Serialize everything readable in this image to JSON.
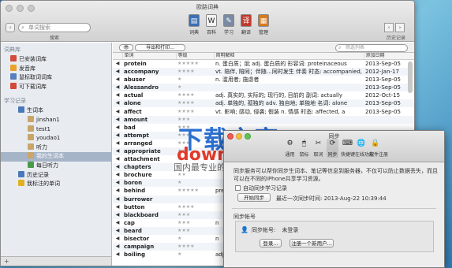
{
  "window": {
    "title": "欧路词典"
  },
  "search": {
    "placeholder": "单词搜索",
    "caption": "搜索",
    "icon": "magnifier-icon"
  },
  "history": {
    "caption": "历史记录"
  },
  "toolbar": [
    {
      "label": "词典",
      "icon": "book-icon",
      "color": "#3a6fb5"
    },
    {
      "label": "百科",
      "icon": "wikipedia-icon",
      "color": "#f2f2f2"
    },
    {
      "label": "学习",
      "icon": "learn-icon",
      "color": "#7a8aa3"
    },
    {
      "label": "翻译",
      "icon": "translate-icon",
      "color": "#c0392b"
    },
    {
      "label": "管理",
      "icon": "manage-icon",
      "color": "#d77b1c"
    }
  ],
  "sidebar": {
    "heading1": "词典库",
    "dict_items": [
      {
        "label": "已安装词库",
        "icon": "installed-icon",
        "color": "#d24a3a"
      },
      {
        "label": "发音库",
        "icon": "pronunciation-icon",
        "color": "#e8a22b"
      },
      {
        "label": "鼠标取词词库",
        "icon": "mouse-icon",
        "color": "#5a7fbf"
      },
      {
        "label": "可下载词库",
        "icon": "download-icon",
        "color": "#d24a3a"
      }
    ],
    "heading2": "学习记录",
    "study_items": [
      {
        "label": "生词本",
        "level": 2,
        "icon": "notebook-icon",
        "color": "#4a78b8"
      },
      {
        "label": "jinshan1",
        "level": 3,
        "icon": "pencil-icon",
        "color": "#c9a56a"
      },
      {
        "label": "test1",
        "level": 3,
        "icon": "pencil-icon",
        "color": "#c9a56a"
      },
      {
        "label": "youdao1",
        "level": 3,
        "icon": "pencil-icon",
        "color": "#c9a56a"
      },
      {
        "label": "听力",
        "level": 3,
        "icon": "pencil-icon",
        "color": "#c9a56a"
      },
      {
        "label": "我的生词本",
        "level": 3,
        "icon": "pencil-icon",
        "color": "#c9a56a",
        "selected": true
      },
      {
        "label": "每日听力",
        "level": 3,
        "icon": "headphone-icon",
        "color": "#4a9a4a"
      },
      {
        "label": "历史记录",
        "level": 2,
        "icon": "history-icon",
        "color": "#4a78b8"
      },
      {
        "label": "我标注的单词",
        "level": 2,
        "icon": "star-icon",
        "color": "#e0b020"
      }
    ],
    "add_button": "+"
  },
  "content": {
    "eye_label": "👁",
    "export_label": "导出和打印...",
    "filter_placeholder": "筛选列表",
    "columns": [
      "",
      "单词",
      "等级",
      "简明解释",
      "添加日期"
    ],
    "rows": [
      {
        "word": "protein",
        "stars": "★★★★★",
        "def": "n. 蛋白质；朊 adj. 蛋白质的 形容词: proteinaceous",
        "date": "2013-Sep-05"
      },
      {
        "word": "accompany",
        "stars": "★★★★",
        "def": "vt. 陪伴, 陪同；伴随…同时发生 伴奏 时态: accompanied, a",
        "date": "2012-Jan-17"
      },
      {
        "word": "abuser",
        "stars": "★",
        "def": "n. 滥用者; 施虐者",
        "date": "2013-Sep-05"
      },
      {
        "word": "Alessandro",
        "stars": "★",
        "def": "",
        "date": "2013-Sep-05"
      },
      {
        "word": "actual",
        "stars": "★★★★",
        "def": "adj. 真实的, 实际的; 现行的, 目前的 副词: actually",
        "date": "2012-Oct-15"
      },
      {
        "word": "alone",
        "stars": "★★★★",
        "def": "adj. 单独的, 孤独的 adv. 独自地; 单独地 名词: alone",
        "date": "2013-Sep-05"
      },
      {
        "word": "affect",
        "stars": "★★★★",
        "def": "vt. 影响; 感动, 侵袭; 假装 n. 情感 时态: affected, a",
        "date": "2013-Sep-05"
      },
      {
        "word": "amount",
        "stars": "★★★",
        "def": "",
        "date": ""
      },
      {
        "word": "bad",
        "stars": "★★★",
        "def": "",
        "date": ""
      },
      {
        "word": "attempt",
        "stars": "★★★",
        "def": "",
        "date": ""
      },
      {
        "word": "arranged",
        "stars": "★★★",
        "def": "",
        "date": ""
      },
      {
        "word": "appropriate",
        "stars": "★★★",
        "def": "",
        "date": ""
      },
      {
        "word": "attachment",
        "stars": "★★",
        "def": "",
        "date": ""
      },
      {
        "word": "chapters",
        "stars": "★★",
        "def": "",
        "date": ""
      },
      {
        "word": "brochure",
        "stars": "★★",
        "def": "",
        "date": ""
      },
      {
        "word": "boron",
        "stars": "★",
        "def": "",
        "date": ""
      },
      {
        "word": "behind",
        "stars": "★★★★★",
        "def": "prep",
        "date": ""
      },
      {
        "word": "burrower",
        "stars": "",
        "def": "",
        "date": ""
      },
      {
        "word": "button",
        "stars": "★★★★",
        "def": "",
        "date": ""
      },
      {
        "word": "blackboard",
        "stars": "★★★",
        "def": "",
        "date": ""
      },
      {
        "word": "cap",
        "stars": "★★★",
        "def": "n",
        "date": ""
      },
      {
        "word": "beard",
        "stars": "★★★",
        "def": "",
        "date": ""
      },
      {
        "word": "bisector",
        "stars": "★",
        "def": "n",
        "date": ""
      },
      {
        "word": "campaign",
        "stars": "★★★★",
        "def": "",
        "date": ""
      },
      {
        "word": "boiling",
        "stars": "★",
        "def": "adj",
        "date": ""
      }
    ]
  },
  "watermark": {
    "line1": "下载之家",
    "line2": "downza.cn",
    "line3": "国内最专业的软件下载"
  },
  "prefs": {
    "title": "同步",
    "tabs": [
      {
        "label": "通用",
        "icon": "general-icon"
      },
      {
        "label": "鼠标",
        "icon": "mouse-icon"
      },
      {
        "label": "取词",
        "icon": "capture-icon"
      },
      {
        "label": "同步",
        "icon": "sync-icon",
        "active": true
      },
      {
        "label": "快捷键",
        "icon": "keyboard-icon"
      },
      {
        "label": "在线功能",
        "icon": "globe-icon"
      },
      {
        "label": "软件注册",
        "icon": "lock-icon"
      }
    ],
    "description": "同步服务可以帮你同步生词本、笔记等信息到服务器，不仅可以防止数据丢失，而且可以在不同的iPhone共享学习资源。",
    "auto_sync_label": "自动同步学习记录",
    "sync_button": "开始同步",
    "last_sync": "最近一次同步时间: 2013-Aug-22 10:39:44",
    "account_title": "同步帐号",
    "account_label": "同步帐号:",
    "account_value": "未登录",
    "login_button": "登录...",
    "register_button": "注册一个新用户..."
  }
}
